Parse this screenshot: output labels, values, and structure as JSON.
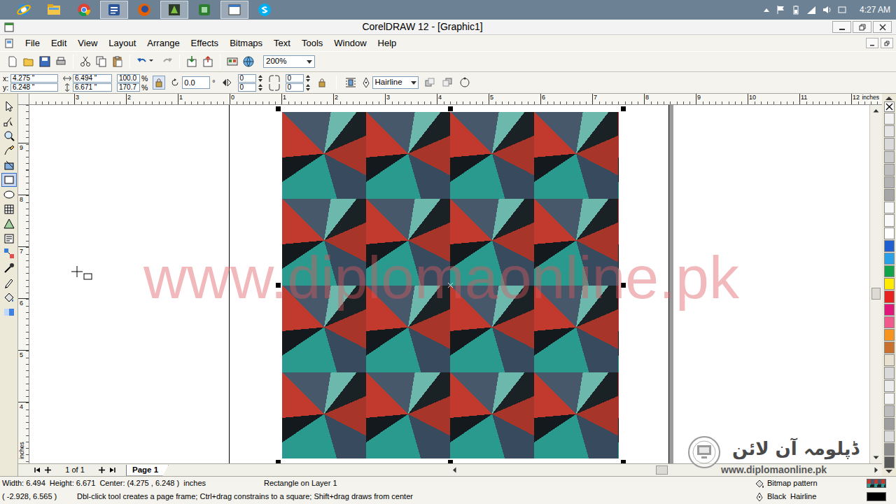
{
  "taskbar": {
    "apps": [
      {
        "kind": "ie",
        "active": false
      },
      {
        "kind": "explorer",
        "active": false
      },
      {
        "kind": "chrome",
        "active": false
      },
      {
        "kind": "word",
        "active": true
      },
      {
        "kind": "firefox",
        "active": false
      },
      {
        "kind": "coreldraw",
        "active": true
      },
      {
        "kind": "camtasia",
        "active": false
      },
      {
        "kind": "recorder",
        "active": true
      },
      {
        "kind": "skype",
        "active": false
      }
    ],
    "clock": "4:27 AM"
  },
  "window": {
    "title": "CorelDRAW 12 - [Graphic1]"
  },
  "menu": {
    "items": [
      "File",
      "Edit",
      "View",
      "Layout",
      "Arrange",
      "Effects",
      "Bitmaps",
      "Text",
      "Tools",
      "Window",
      "Help"
    ]
  },
  "toolbar": {
    "zoom": "200%"
  },
  "property_bar": {
    "position": [
      {
        "label": "x:",
        "value": "4.275 \""
      },
      {
        "label": "y:",
        "value": "6.248 \""
      }
    ],
    "size": [
      "6.494 \"",
      "6.671 \""
    ],
    "scale": [
      {
        "value": "100.0",
        "unit": "%"
      },
      {
        "value": "170.7",
        "unit": "%"
      }
    ],
    "proportional_lock": true,
    "rotation": {
      "value": "0.0",
      "unit": "°"
    },
    "corners": [
      "0",
      "0",
      "0",
      "0"
    ],
    "outline": "Hairline"
  },
  "rulers": {
    "horizontal": [
      "3",
      "2",
      "1",
      "0",
      "1",
      "2",
      "3",
      "4",
      "5",
      "6",
      "7",
      "8",
      "9",
      "10",
      "11",
      "12"
    ],
    "unit": "inches",
    "vertical": [
      "9",
      "8",
      "7",
      "6",
      "5",
      "4"
    ],
    "vertical_unit": "inches"
  },
  "toolbox": {
    "tools": [
      {
        "kind": "pick",
        "selected": false
      },
      {
        "kind": "shape",
        "selected": false
      },
      {
        "kind": "zoom",
        "selected": false
      },
      {
        "kind": "freehand",
        "selected": false
      },
      {
        "kind": "smart",
        "selected": false
      },
      {
        "kind": "rectangle",
        "selected": true
      },
      {
        "kind": "ellipse",
        "selected": false
      },
      {
        "kind": "graph",
        "selected": false
      },
      {
        "kind": "basic",
        "selected": false
      },
      {
        "kind": "text",
        "selected": false
      },
      {
        "kind": "blend",
        "selected": false
      },
      {
        "kind": "eyedropper",
        "selected": false
      },
      {
        "kind": "outline",
        "selected": false
      },
      {
        "kind": "fill",
        "selected": false
      },
      {
        "kind": "ifill",
        "selected": false
      }
    ]
  },
  "canvas": {
    "object": {
      "selected": true
    },
    "watermark": "www.diplomaonline.pk"
  },
  "palette": {
    "swatches": [
      {
        "color": "#f2f2f2"
      },
      {
        "color": "#e6e6e6"
      },
      {
        "color": "#d9d9d9"
      },
      {
        "color": "#cccccc"
      },
      {
        "color": "#bfbfbf"
      },
      {
        "color": "#b3b3b3"
      },
      {
        "color": "#a6a6a6"
      },
      {
        "color": "#f7f7f7"
      },
      {
        "color": "#fafafa"
      },
      {
        "color": "#ffffff"
      },
      {
        "color": "#1f5fd0"
      },
      {
        "color": "#2aa0e6"
      },
      {
        "color": "#12a24a"
      },
      {
        "color": "#ffea00"
      },
      {
        "color": "#e8231f"
      },
      {
        "color": "#e0187a"
      },
      {
        "color": "#f05a8c"
      },
      {
        "color": "#f7941d"
      },
      {
        "color": "#c8702c"
      },
      {
        "color": "#e8e0d0"
      },
      {
        "color": "#d9d9d9"
      },
      {
        "color": "#ececec"
      },
      {
        "color": "#f4f4f4"
      },
      {
        "color": "#bdbdbd"
      },
      {
        "color": "#9e9e9e"
      },
      {
        "color": "#dcdcdc"
      },
      {
        "color": "#8c8c8c"
      },
      {
        "color": "#5a5a5a"
      }
    ]
  },
  "page_nav": {
    "count": "1 of 1",
    "tab": "Page 1"
  },
  "status_bar": {
    "size": "Width: 6.494  Height: 6.671  Center: (4.275 , 6.248 )  inches",
    "object": "Rectangle on Layer 1",
    "cursor": "( -2.928, 6.565 )",
    "hint": "Dbl-click tool creates a page frame; Ctrl+drag constrains to a square; Shift+drag draws from center",
    "fill": "Bitmap pattern",
    "outline": {
      "label": "Black  Hairline",
      "color": "#000000"
    }
  },
  "logo": {
    "name": "ڈپلومہ آن لائن",
    "url": "www.diplomaonline.pk"
  }
}
